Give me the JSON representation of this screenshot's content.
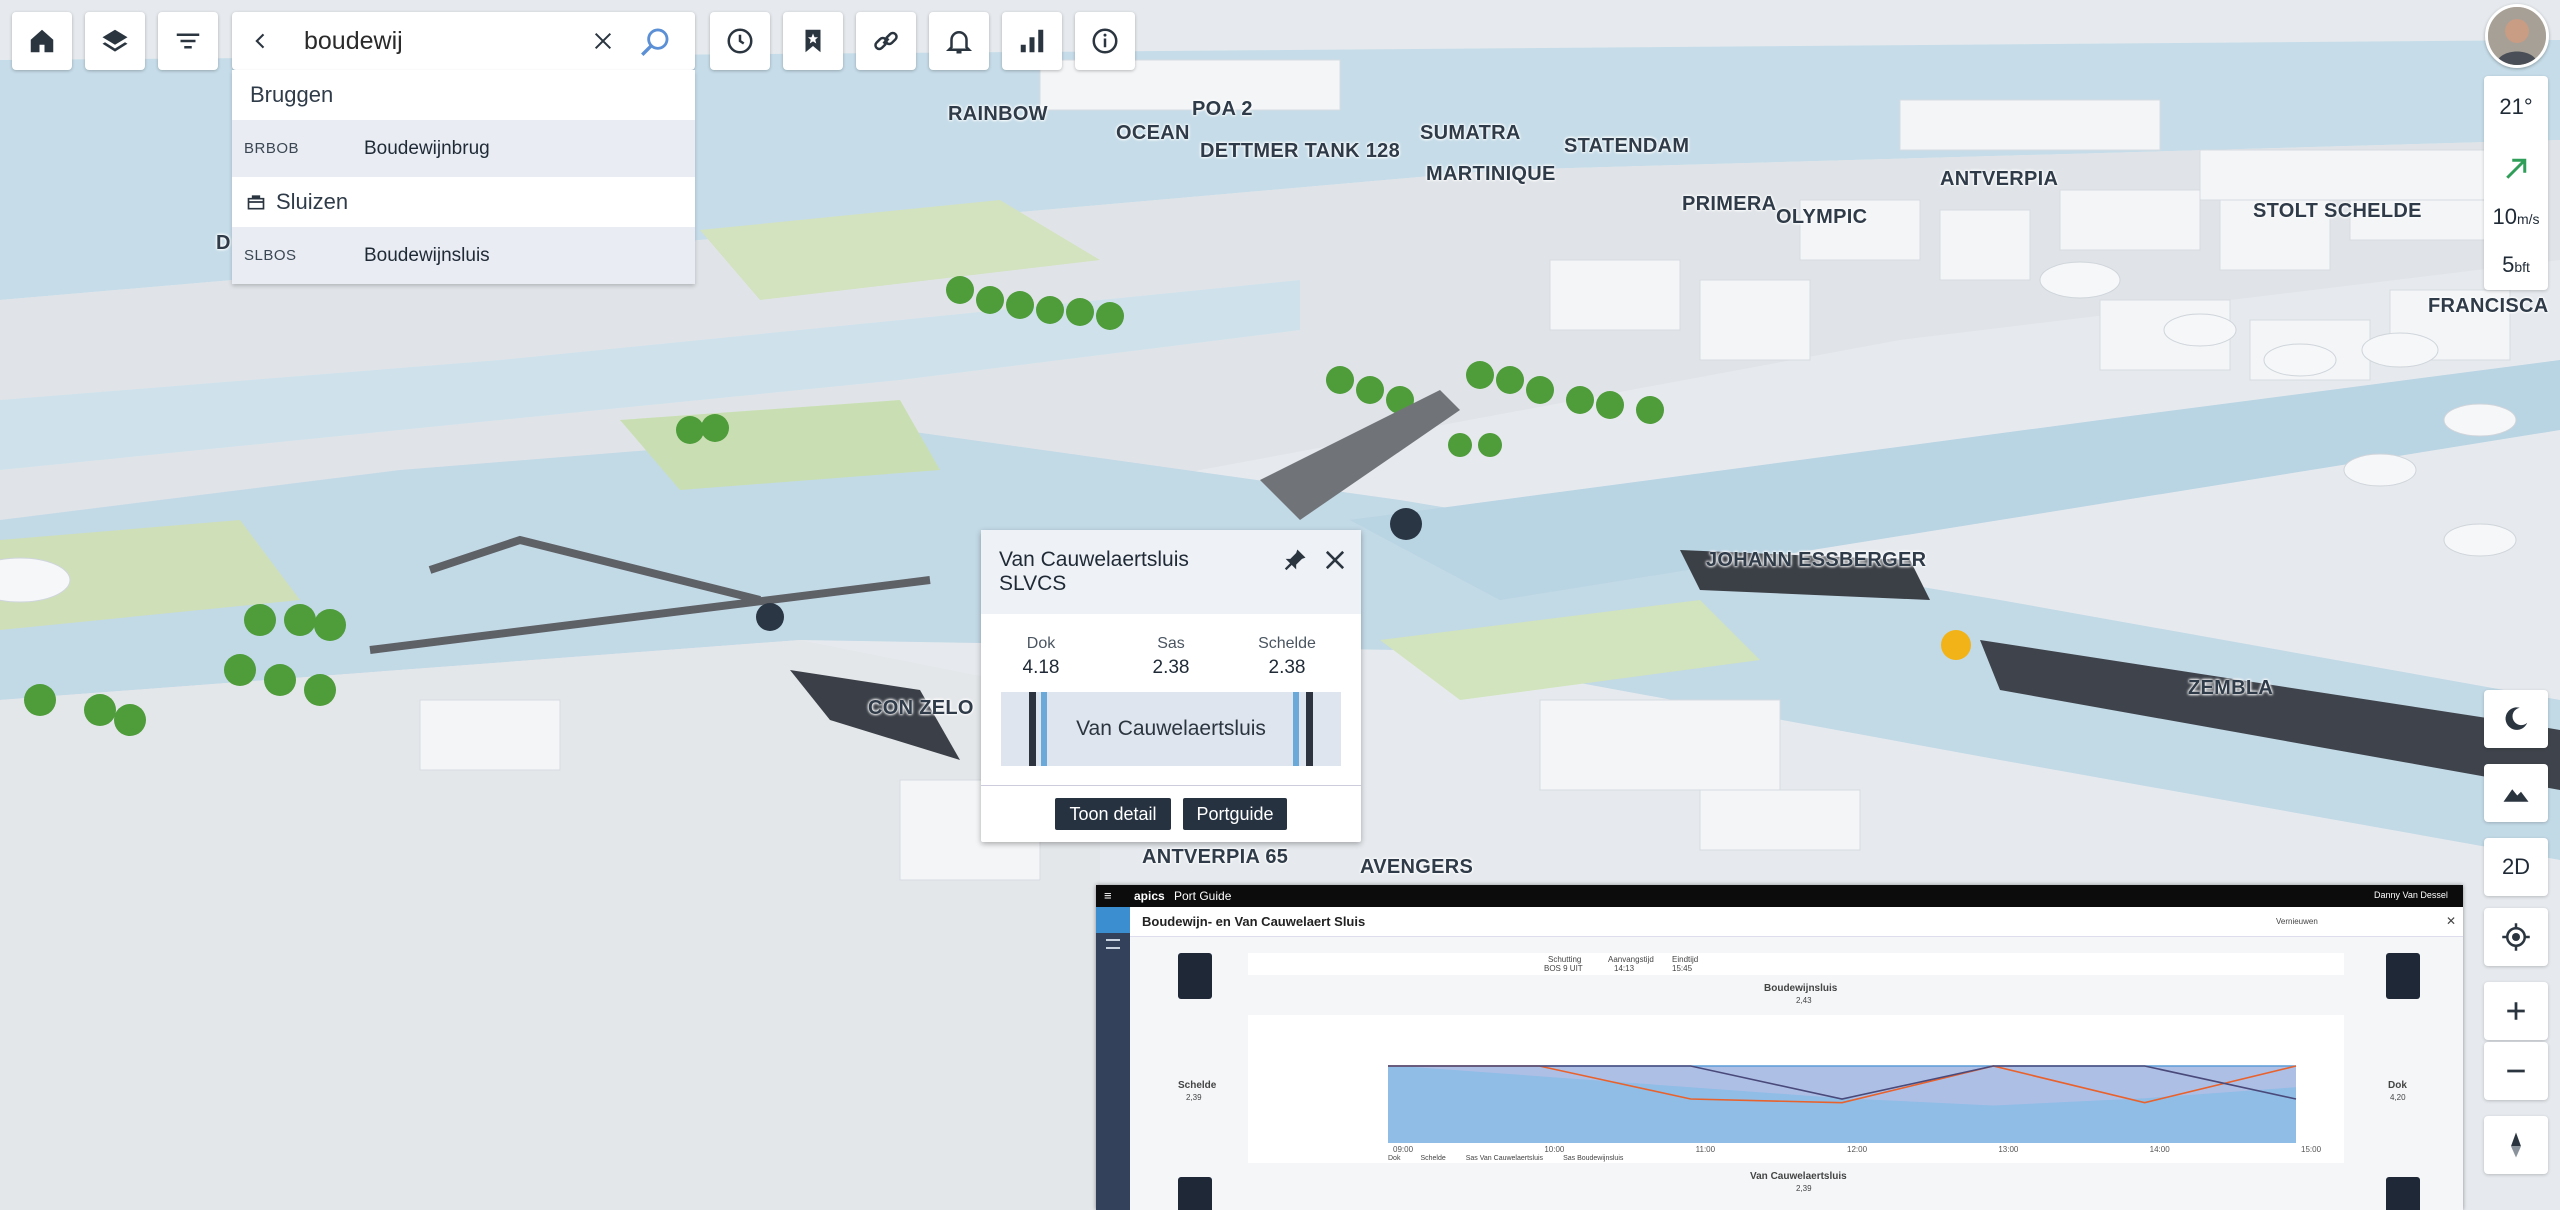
{
  "toolbar": {
    "home": "home-icon",
    "layers": "layers-icon",
    "filter": "filter-icon",
    "history": "clock-icon",
    "bookmarks": "bookmark-icon",
    "links": "link-icon",
    "alerts": "bell-icon",
    "stats": "chart-icon",
    "info": "info-icon"
  },
  "search": {
    "value": "boudewij",
    "placeholder": ""
  },
  "results": {
    "cat1": "Bruggen",
    "row1_code": "BRBOB",
    "row1_name": "Boudewijnbrug",
    "cat2": "Sluizen",
    "row2_code": "SLBOS",
    "row2_name": "Boudewijnsluis"
  },
  "weather": {
    "temp": "21°",
    "wind": "10",
    "wind_unit": "m/s",
    "bft": "5",
    "bft_unit": "bft"
  },
  "right_buttons": {
    "view_2d": "2D"
  },
  "map_labels": {
    "rainbow": "RAINBOW",
    "poa2": "POA 2",
    "ocean": "OCEAN",
    "dettmer": "DETTMER TANK 128",
    "sumatra": "SUMATRA",
    "martinique": "MARTINIQUE",
    "statendam": "STATENDAM",
    "primera": "PRIMERA",
    "olympic": "OLYMPIC",
    "antverpia": "ANTVERPIA",
    "stolt": "STOLT SCHELDE",
    "francisca": "FRANCISCA",
    "johann": "JOHANN ESSBERGER",
    "zembla": "ZEMBLA",
    "conzelo": "CON ZELO",
    "antverpia65": "ANTVERPIA 65",
    "avengers": "AVENGERS",
    "d": "D"
  },
  "popup": {
    "title": "Van Cauwelaertsluis",
    "code": "SLVCS",
    "dok_label": "Dok",
    "dok_value": "4.18",
    "sas_label": "Sas",
    "sas_value": "2.38",
    "schelde_label": "Schelde",
    "schelde_value": "2.38",
    "lock_name": "Van Cauwelaertsluis",
    "btn_detail": "Toon detail",
    "btn_portguide": "Portguide"
  },
  "portguide": {
    "brand": "apics",
    "app": "Port Guide",
    "user": "Danny Van Dessel",
    "title": "Boudewijn- en Van Cauwelaert Sluis",
    "refresh": "Vernieuwen",
    "schutting_label": "Schutting",
    "schutting_val": "BOS 9 UIT",
    "aanvang_label": "Aanvangstijd",
    "aanvang_val": "14:13",
    "eind_label": "Eindtijd",
    "eind_val": "15:45",
    "lock1": "Boudewijnsluis",
    "lock1_val": "2,43",
    "lock2": "Van Cauwelaertsluis",
    "lock2_val": "2,39",
    "schelde": "Schelde",
    "schelde_val": "2,39",
    "dok": "Dok",
    "dok_val": "4,20",
    "legend1": "Dok",
    "legend2": "Schelde",
    "legend3": "Sas Van Cauwelaertsluis",
    "legend4": "Sas Boudewijnsluis"
  },
  "chart_data": {
    "type": "line",
    "x": [
      "09:00",
      "10:00",
      "11:00",
      "12:00",
      "13:00",
      "14:00",
      "15:00"
    ],
    "ylim": [
      0,
      6
    ],
    "series": [
      {
        "name": "Dok",
        "values": [
          4.2,
          4.2,
          4.2,
          4.2,
          4.2,
          4.2,
          4.2
        ]
      },
      {
        "name": "Schelde",
        "values": [
          4.2,
          3.6,
          3.0,
          2.4,
          2.0,
          2.4,
          3.0
        ]
      },
      {
        "name": "Sas Van Cauwelaertsluis",
        "values": [
          4.2,
          4.2,
          2.4,
          2.2,
          4.2,
          2.2,
          4.2
        ]
      },
      {
        "name": "Sas Boudewijnsluis",
        "values": [
          4.2,
          4.2,
          4.2,
          2.4,
          4.2,
          4.2,
          2.4
        ]
      }
    ],
    "colors": {
      "dok": "#5b9bd5",
      "schelde": "#8fbde6",
      "sas_vc": "#e8622d",
      "sas_bw": "#4a4a7a"
    }
  }
}
